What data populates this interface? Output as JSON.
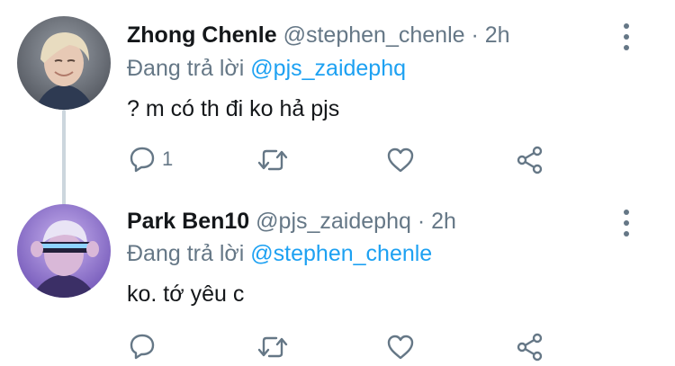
{
  "tweets": [
    {
      "display_name": "Zhong Chenle",
      "handle": "@stephen_chenle",
      "separator": "·",
      "time": "2h",
      "reply_prefix": "Đang trả lời",
      "reply_to": "@pjs_zaidephq",
      "text": "? m có th đi ko hả pjs",
      "reply_count": "1",
      "avatar": "avatar-photo-blond-hair"
    },
    {
      "display_name": "Park Ben10",
      "handle": "@pjs_zaidephq",
      "separator": "·",
      "time": "2h",
      "reply_prefix": "Đang trả lời",
      "reply_to": "@stephen_chenle",
      "text": "ko. tớ yêu c",
      "reply_count": "",
      "avatar": "avatar-photo-purple-visor"
    }
  ],
  "icons": {
    "reply": "reply-icon",
    "retweet": "retweet-icon",
    "like": "heart-icon",
    "share": "share-icon",
    "more": "more-options-icon"
  },
  "colors": {
    "text": "#14171a",
    "secondary": "#657786",
    "link": "#1da1f2",
    "thread": "#ccd6dd"
  }
}
